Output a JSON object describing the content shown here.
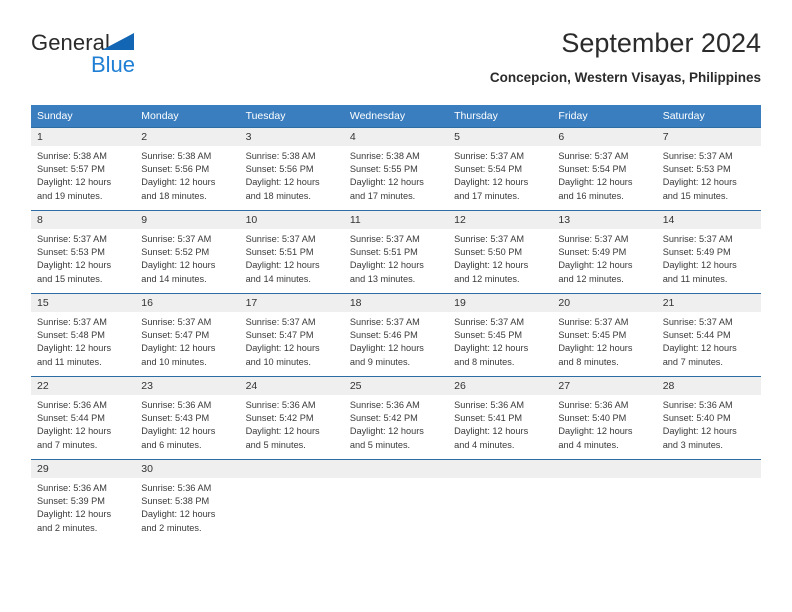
{
  "branding": {
    "name_primary": "General",
    "name_secondary": "Blue",
    "accent_color": "#1f7fd4",
    "triangle_color": "#1266b3"
  },
  "header": {
    "title": "September 2024",
    "subtitle": "Concepcion, Western Visayas, Philippines"
  },
  "calendar": {
    "header_bg": "#3a7ebf",
    "header_text_color": "#ffffff",
    "daynum_bg": "#efefef",
    "row_border_color": "#2e6da4",
    "weekdays": [
      "Sunday",
      "Monday",
      "Tuesday",
      "Wednesday",
      "Thursday",
      "Friday",
      "Saturday"
    ],
    "weeks": [
      [
        {
          "day": "1",
          "sunrise": "Sunrise: 5:38 AM",
          "sunset": "Sunset: 5:57 PM",
          "daylight_line1": "Daylight: 12 hours",
          "daylight_line2": "and 19 minutes."
        },
        {
          "day": "2",
          "sunrise": "Sunrise: 5:38 AM",
          "sunset": "Sunset: 5:56 PM",
          "daylight_line1": "Daylight: 12 hours",
          "daylight_line2": "and 18 minutes."
        },
        {
          "day": "3",
          "sunrise": "Sunrise: 5:38 AM",
          "sunset": "Sunset: 5:56 PM",
          "daylight_line1": "Daylight: 12 hours",
          "daylight_line2": "and 18 minutes."
        },
        {
          "day": "4",
          "sunrise": "Sunrise: 5:38 AM",
          "sunset": "Sunset: 5:55 PM",
          "daylight_line1": "Daylight: 12 hours",
          "daylight_line2": "and 17 minutes."
        },
        {
          "day": "5",
          "sunrise": "Sunrise: 5:37 AM",
          "sunset": "Sunset: 5:54 PM",
          "daylight_line1": "Daylight: 12 hours",
          "daylight_line2": "and 17 minutes."
        },
        {
          "day": "6",
          "sunrise": "Sunrise: 5:37 AM",
          "sunset": "Sunset: 5:54 PM",
          "daylight_line1": "Daylight: 12 hours",
          "daylight_line2": "and 16 minutes."
        },
        {
          "day": "7",
          "sunrise": "Sunrise: 5:37 AM",
          "sunset": "Sunset: 5:53 PM",
          "daylight_line1": "Daylight: 12 hours",
          "daylight_line2": "and 15 minutes."
        }
      ],
      [
        {
          "day": "8",
          "sunrise": "Sunrise: 5:37 AM",
          "sunset": "Sunset: 5:53 PM",
          "daylight_line1": "Daylight: 12 hours",
          "daylight_line2": "and 15 minutes."
        },
        {
          "day": "9",
          "sunrise": "Sunrise: 5:37 AM",
          "sunset": "Sunset: 5:52 PM",
          "daylight_line1": "Daylight: 12 hours",
          "daylight_line2": "and 14 minutes."
        },
        {
          "day": "10",
          "sunrise": "Sunrise: 5:37 AM",
          "sunset": "Sunset: 5:51 PM",
          "daylight_line1": "Daylight: 12 hours",
          "daylight_line2": "and 14 minutes."
        },
        {
          "day": "11",
          "sunrise": "Sunrise: 5:37 AM",
          "sunset": "Sunset: 5:51 PM",
          "daylight_line1": "Daylight: 12 hours",
          "daylight_line2": "and 13 minutes."
        },
        {
          "day": "12",
          "sunrise": "Sunrise: 5:37 AM",
          "sunset": "Sunset: 5:50 PM",
          "daylight_line1": "Daylight: 12 hours",
          "daylight_line2": "and 12 minutes."
        },
        {
          "day": "13",
          "sunrise": "Sunrise: 5:37 AM",
          "sunset": "Sunset: 5:49 PM",
          "daylight_line1": "Daylight: 12 hours",
          "daylight_line2": "and 12 minutes."
        },
        {
          "day": "14",
          "sunrise": "Sunrise: 5:37 AM",
          "sunset": "Sunset: 5:49 PM",
          "daylight_line1": "Daylight: 12 hours",
          "daylight_line2": "and 11 minutes."
        }
      ],
      [
        {
          "day": "15",
          "sunrise": "Sunrise: 5:37 AM",
          "sunset": "Sunset: 5:48 PM",
          "daylight_line1": "Daylight: 12 hours",
          "daylight_line2": "and 11 minutes."
        },
        {
          "day": "16",
          "sunrise": "Sunrise: 5:37 AM",
          "sunset": "Sunset: 5:47 PM",
          "daylight_line1": "Daylight: 12 hours",
          "daylight_line2": "and 10 minutes."
        },
        {
          "day": "17",
          "sunrise": "Sunrise: 5:37 AM",
          "sunset": "Sunset: 5:47 PM",
          "daylight_line1": "Daylight: 12 hours",
          "daylight_line2": "and 10 minutes."
        },
        {
          "day": "18",
          "sunrise": "Sunrise: 5:37 AM",
          "sunset": "Sunset: 5:46 PM",
          "daylight_line1": "Daylight: 12 hours",
          "daylight_line2": "and 9 minutes."
        },
        {
          "day": "19",
          "sunrise": "Sunrise: 5:37 AM",
          "sunset": "Sunset: 5:45 PM",
          "daylight_line1": "Daylight: 12 hours",
          "daylight_line2": "and 8 minutes."
        },
        {
          "day": "20",
          "sunrise": "Sunrise: 5:37 AM",
          "sunset": "Sunset: 5:45 PM",
          "daylight_line1": "Daylight: 12 hours",
          "daylight_line2": "and 8 minutes."
        },
        {
          "day": "21",
          "sunrise": "Sunrise: 5:37 AM",
          "sunset": "Sunset: 5:44 PM",
          "daylight_line1": "Daylight: 12 hours",
          "daylight_line2": "and 7 minutes."
        }
      ],
      [
        {
          "day": "22",
          "sunrise": "Sunrise: 5:36 AM",
          "sunset": "Sunset: 5:44 PM",
          "daylight_line1": "Daylight: 12 hours",
          "daylight_line2": "and 7 minutes."
        },
        {
          "day": "23",
          "sunrise": "Sunrise: 5:36 AM",
          "sunset": "Sunset: 5:43 PM",
          "daylight_line1": "Daylight: 12 hours",
          "daylight_line2": "and 6 minutes."
        },
        {
          "day": "24",
          "sunrise": "Sunrise: 5:36 AM",
          "sunset": "Sunset: 5:42 PM",
          "daylight_line1": "Daylight: 12 hours",
          "daylight_line2": "and 5 minutes."
        },
        {
          "day": "25",
          "sunrise": "Sunrise: 5:36 AM",
          "sunset": "Sunset: 5:42 PM",
          "daylight_line1": "Daylight: 12 hours",
          "daylight_line2": "and 5 minutes."
        },
        {
          "day": "26",
          "sunrise": "Sunrise: 5:36 AM",
          "sunset": "Sunset: 5:41 PM",
          "daylight_line1": "Daylight: 12 hours",
          "daylight_line2": "and 4 minutes."
        },
        {
          "day": "27",
          "sunrise": "Sunrise: 5:36 AM",
          "sunset": "Sunset: 5:40 PM",
          "daylight_line1": "Daylight: 12 hours",
          "daylight_line2": "and 4 minutes."
        },
        {
          "day": "28",
          "sunrise": "Sunrise: 5:36 AM",
          "sunset": "Sunset: 5:40 PM",
          "daylight_line1": "Daylight: 12 hours",
          "daylight_line2": "and 3 minutes."
        }
      ],
      [
        {
          "day": "29",
          "sunrise": "Sunrise: 5:36 AM",
          "sunset": "Sunset: 5:39 PM",
          "daylight_line1": "Daylight: 12 hours",
          "daylight_line2": "and 2 minutes."
        },
        {
          "day": "30",
          "sunrise": "Sunrise: 5:36 AM",
          "sunset": "Sunset: 5:38 PM",
          "daylight_line1": "Daylight: 12 hours",
          "daylight_line2": "and 2 minutes."
        },
        {
          "day": "",
          "sunrise": "",
          "sunset": "",
          "daylight_line1": "",
          "daylight_line2": ""
        },
        {
          "day": "",
          "sunrise": "",
          "sunset": "",
          "daylight_line1": "",
          "daylight_line2": ""
        },
        {
          "day": "",
          "sunrise": "",
          "sunset": "",
          "daylight_line1": "",
          "daylight_line2": ""
        },
        {
          "day": "",
          "sunrise": "",
          "sunset": "",
          "daylight_line1": "",
          "daylight_line2": ""
        },
        {
          "day": "",
          "sunrise": "",
          "sunset": "",
          "daylight_line1": "",
          "daylight_line2": ""
        }
      ]
    ]
  }
}
